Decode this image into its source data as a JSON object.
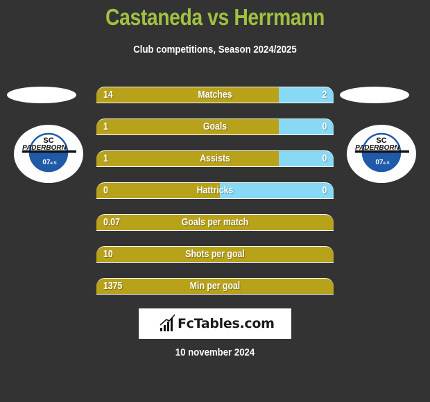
{
  "header": {
    "title": "Castaneda vs Herrmann",
    "subtitle": "Club competitions, Season 2024/2025"
  },
  "colors": {
    "background": "#333333",
    "title": "#a0c040",
    "left_bar": "#b8a21a",
    "right_bar": "#87d9f5"
  },
  "players": {
    "left": {
      "name": "Castaneda",
      "club_logo": "sc-paderborn-logo",
      "club_text": [
        "SC",
        "PADERBORN",
        "07e.V."
      ]
    },
    "right": {
      "name": "Herrmann",
      "club_logo": "sc-paderborn-logo",
      "club_text": [
        "SC",
        "PADERBORN",
        "07e.V."
      ]
    }
  },
  "stats": [
    {
      "label": "Matches",
      "left": "14",
      "right": "2",
      "left_share": 0.769
    },
    {
      "label": "Goals",
      "left": "1",
      "right": "0",
      "left_share": 0.769
    },
    {
      "label": "Assists",
      "left": "1",
      "right": "0",
      "left_share": 0.769
    },
    {
      "label": "Hattricks",
      "left": "0",
      "right": "0",
      "left_share": 0.52
    },
    {
      "label": "Goals per match",
      "left": "0.07",
      "right": "",
      "left_share": 1.0
    },
    {
      "label": "Shots per goal",
      "left": "10",
      "right": "",
      "left_share": 1.0
    },
    {
      "label": "Min per goal",
      "left": "1375",
      "right": "",
      "left_share": 1.0
    }
  ],
  "footer": {
    "brand": "FcTables.com",
    "brand_icon": "bar-chart-trend-icon",
    "date": "10 november 2024"
  }
}
